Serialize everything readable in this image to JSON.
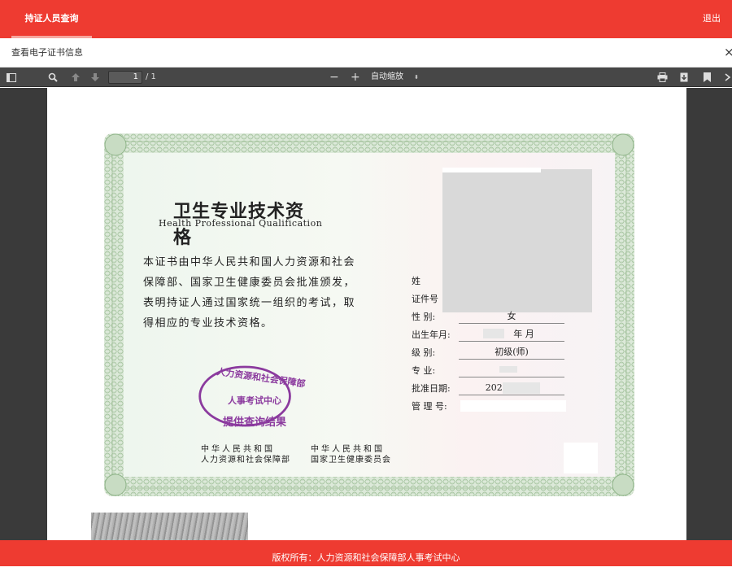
{
  "topbar": {
    "tab_label": "持证人员查询",
    "logout_label": "退出"
  },
  "subbar": {
    "title": "查看电子证书信息",
    "close_symbol": "×"
  },
  "toolbar": {
    "page_current": "1",
    "page_total": "/ 1",
    "zoom_minus": "−",
    "zoom_plus": "+",
    "zoom_value": "自动缩放",
    "zoom_arrow": "⬍"
  },
  "certificate": {
    "title": "卫生专业技术资格",
    "subtitle": "Health Professional Qualification",
    "paragraph": "本证书由中华人民共和国人力资源和社会保障部、国家卫生健康委员会批准颁发，表明持证人通过国家统一组织的考试，取得相应的专业技术资格。",
    "fields": [
      {
        "label": "姓",
        "value": ""
      },
      {
        "label": "证件号",
        "value": ""
      },
      {
        "label": "性 别:",
        "value": "女"
      },
      {
        "label": "出生年月:",
        "value": "年 月"
      },
      {
        "label": "级 别:",
        "value": "初级(师)"
      },
      {
        "label": "专 业:",
        "value": ""
      },
      {
        "label": "批准日期:",
        "value": "2020年 月日"
      },
      {
        "label": "管 理 号:",
        "value": ""
      }
    ],
    "stamp": {
      "arc": "人力资源和社会保障部",
      "middle": "人事考试中心",
      "bottom": "提供查询结果"
    },
    "issuer_left": [
      "中华人民共和国",
      "人力资源和社会保障部"
    ],
    "issuer_right": [
      "中华人民共和国",
      "国家卫生健康委员会"
    ]
  },
  "footer": {
    "copyright": "版权所有：人力资源和社会保障部人事考试中心"
  },
  "colors": {
    "brand_red": "#ee3b31",
    "toolbar_gray": "#474747",
    "stamp_purple": "#8b3a9e"
  }
}
